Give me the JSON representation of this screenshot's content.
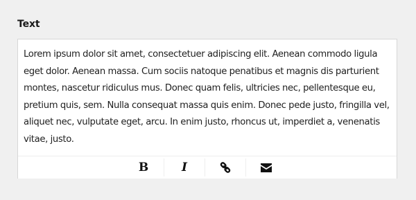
{
  "field": {
    "label": "Text"
  },
  "editor": {
    "content": "Lorem ipsum dolor sit amet, consectetuer adipiscing elit. Aenean commodo ligula eget dolor. Aenean massa. Cum sociis natoque penatibus et magnis dis parturient montes, nascetur ridiculus mus. Donec quam felis, ultricies nec, pellentesque eu, pretium quis, sem. Nulla consequat massa quis enim. Donec pede justo, fringilla vel, aliquet nec, vulputate eget, arcu. In enim justo, rhoncus ut, imperdiet a, venenatis vitae, justo."
  },
  "toolbar": {
    "bold_label": "B",
    "italic_label": "I",
    "icons": {
      "link": "link-icon",
      "email": "envelope-icon"
    }
  },
  "colors": {
    "page_background": "#f0f0f0",
    "editor_background": "#ffffff",
    "border": "#d7d7d7",
    "text": "#1f1f1f",
    "icon": "#111111"
  }
}
